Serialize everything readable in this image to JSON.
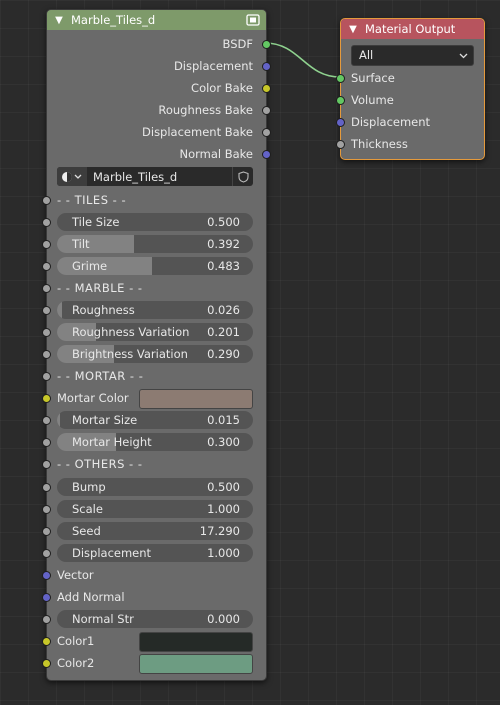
{
  "group_node": {
    "title": "Marble_Tiles_d",
    "outputs": [
      "BSDF",
      "Displacement",
      "Color Bake",
      "Roughness Bake",
      "Displacement Bake",
      "Normal Bake"
    ],
    "datablock_name": "Marble_Tiles_d",
    "inputs": {
      "tiles_header": "- - TILES - -",
      "tile_size": {
        "label": "Tile Size",
        "value": "0.500",
        "fill": 0
      },
      "tilt": {
        "label": "Tilt",
        "value": "0.392",
        "fill": 0.392
      },
      "grime": {
        "label": "Grime",
        "value": "0.483",
        "fill": 0.483
      },
      "marble_header": "- - MARBLE - -",
      "roughness": {
        "label": "Roughness",
        "value": "0.026",
        "fill": 0.026
      },
      "roughness_variation": {
        "label": "Roughness Variation",
        "value": "0.201",
        "fill": 0.201
      },
      "brightness_variation": {
        "label": "Brightness Variation",
        "value": "0.290",
        "fill": 0.29
      },
      "mortar_header": "- - MORTAR - -",
      "mortar_color": {
        "label": "Mortar Color",
        "color": "#8c7b72"
      },
      "mortar_size": {
        "label": "Mortar Size",
        "value": "0.015",
        "fill": 0.015
      },
      "mortar_height": {
        "label": "Mortar Height",
        "value": "0.300",
        "fill": 0.3
      },
      "others_header": "- - OTHERS - -",
      "bump": {
        "label": "Bump",
        "value": "0.500",
        "fill": 0
      },
      "scale": {
        "label": "Scale",
        "value": "1.000",
        "fill": 0
      },
      "seed": {
        "label": "Seed",
        "value": "17.290",
        "fill": 0
      },
      "displacement": {
        "label": "Displacement",
        "value": "1.000",
        "fill": 0
      },
      "vector": {
        "label": "Vector"
      },
      "add_normal": {
        "label": "Add Normal"
      },
      "normal_str": {
        "label": "Normal Str",
        "value": "0.000",
        "fill": 0
      },
      "color1": {
        "label": "Color1",
        "color": "#252a27"
      },
      "color2": {
        "label": "Color2",
        "color": "#6d9c82"
      }
    }
  },
  "output_node": {
    "title": "Material Output",
    "target": "All",
    "inputs": [
      "Surface",
      "Volume",
      "Displacement",
      "Thickness"
    ]
  },
  "colors": {
    "grey_socket": "#a1a1a1",
    "vector_socket": "#6363c7",
    "color_socket": "#c7c729",
    "shader_socket": "#63c763",
    "group_header": "#7e9a6a",
    "output_header": "#b7545e"
  },
  "icons": [
    "chevron-down-icon",
    "node-tree-icon",
    "material-sphere-icon",
    "shield-icon"
  ]
}
